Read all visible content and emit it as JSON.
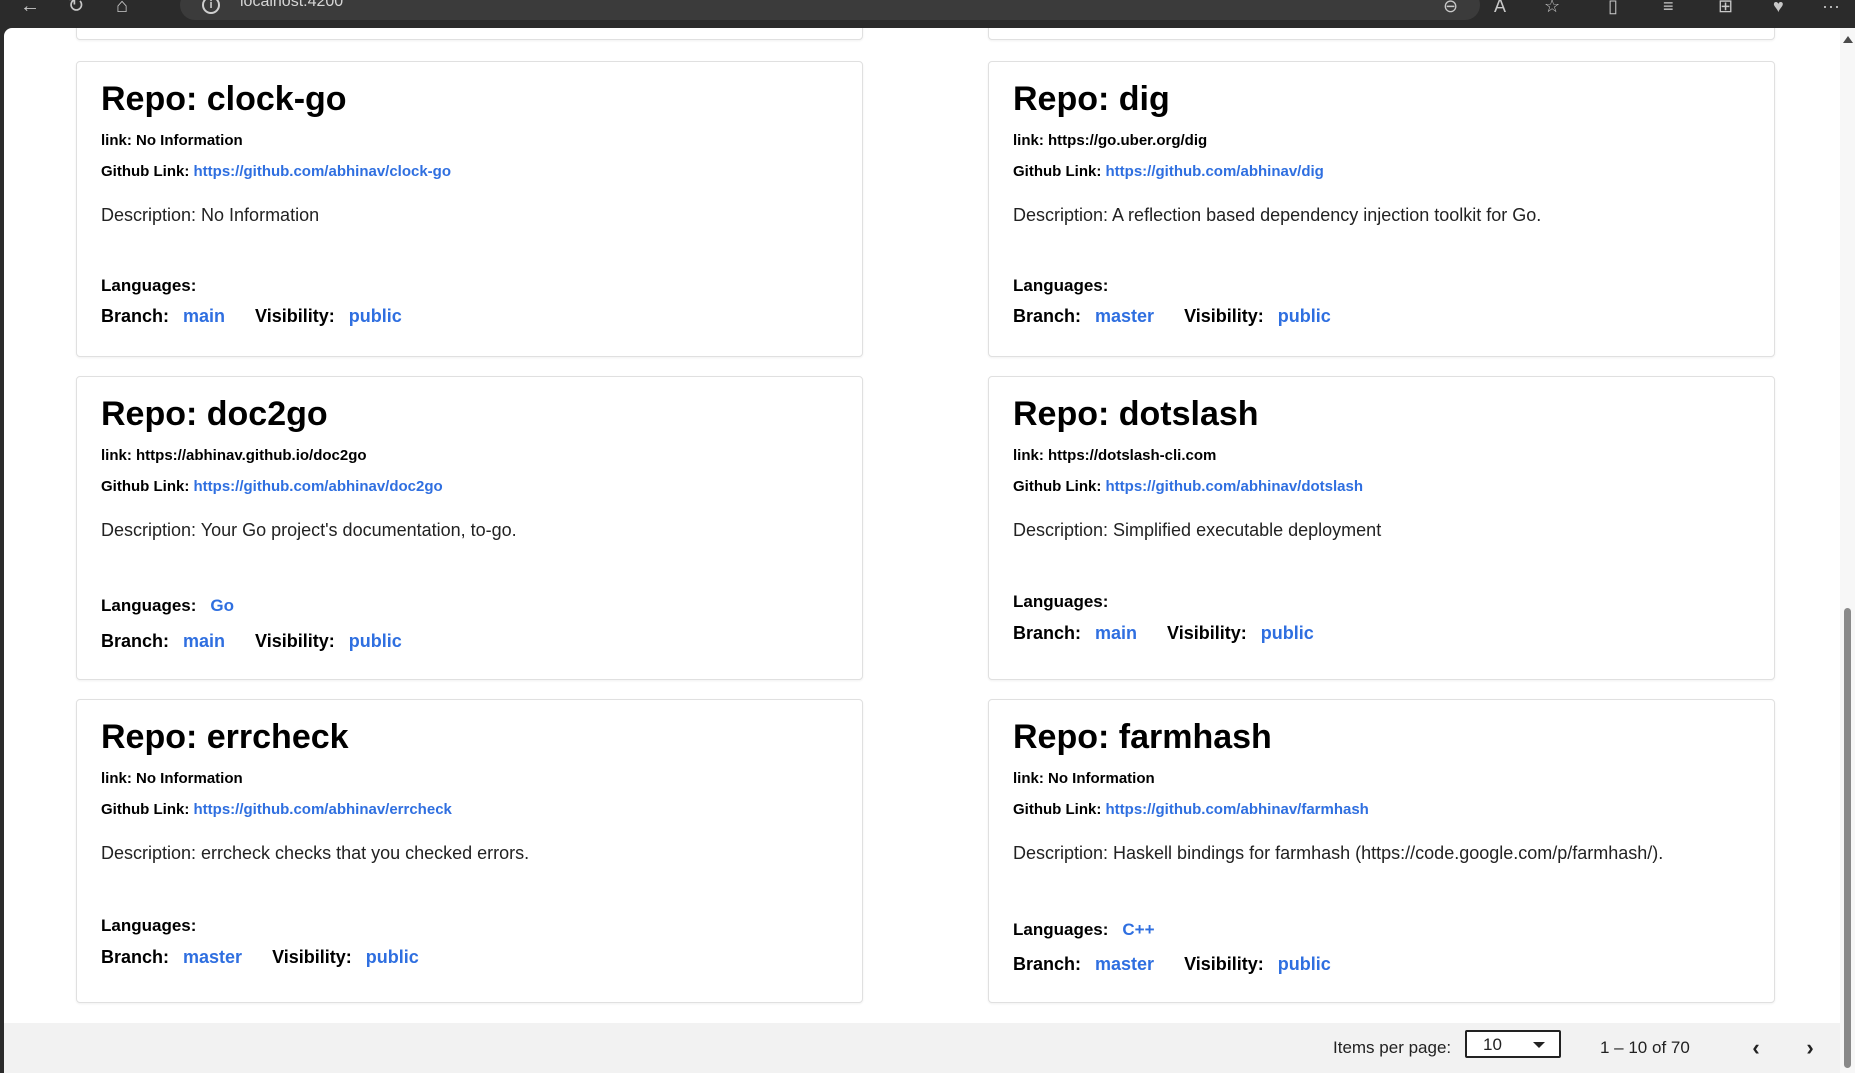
{
  "browser": {
    "url": "localhost:4200",
    "back_icon": "←",
    "refresh_icon": "↻",
    "home_icon": "⌂",
    "more_icon": "···"
  },
  "repos": [
    {
      "title": "Repo: clock-go",
      "link_label": "link:",
      "link_value": "No Information",
      "github_label": "Github Link:",
      "github_url": "https://github.com/abhinav/clock-go",
      "description": "Description: No Information",
      "languages_label": "Languages:",
      "languages_value": "",
      "branch_label": "Branch:",
      "branch_value": "main",
      "visibility_label": "Visibility:",
      "visibility_value": "public"
    },
    {
      "title": "Repo: dig",
      "link_label": "link:",
      "link_value": "https://go.uber.org/dig",
      "github_label": "Github Link:",
      "github_url": "https://github.com/abhinav/dig",
      "description": "Description: A reflection based dependency injection toolkit for Go.",
      "languages_label": "Languages:",
      "languages_value": "",
      "branch_label": "Branch:",
      "branch_value": "master",
      "visibility_label": "Visibility:",
      "visibility_value": "public"
    },
    {
      "title": "Repo: doc2go",
      "link_label": "link:",
      "link_value": "https://abhinav.github.io/doc2go",
      "github_label": "Github Link:",
      "github_url": "https://github.com/abhinav/doc2go",
      "description": "Description: Your Go project's documentation, to-go.",
      "languages_label": "Languages:",
      "languages_value": "Go",
      "branch_label": "Branch:",
      "branch_value": "main",
      "visibility_label": "Visibility:",
      "visibility_value": "public"
    },
    {
      "title": "Repo: dotslash",
      "link_label": "link:",
      "link_value": "https://dotslash-cli.com",
      "github_label": "Github Link:",
      "github_url": "https://github.com/abhinav/dotslash",
      "description": "Description: Simplified executable deployment",
      "languages_label": "Languages:",
      "languages_value": "",
      "branch_label": "Branch:",
      "branch_value": "main",
      "visibility_label": "Visibility:",
      "visibility_value": "public"
    },
    {
      "title": "Repo: errcheck",
      "link_label": "link:",
      "link_value": "No Information",
      "github_label": "Github Link:",
      "github_url": "https://github.com/abhinav/errcheck",
      "description": "Description: errcheck checks that you checked errors.",
      "languages_label": "Languages:",
      "languages_value": "",
      "branch_label": "Branch:",
      "branch_value": "master",
      "visibility_label": "Visibility:",
      "visibility_value": "public"
    },
    {
      "title": "Repo: farmhash",
      "link_label": "link:",
      "link_value": "No Information",
      "github_label": "Github Link:",
      "github_url": "https://github.com/abhinav/farmhash",
      "description": "Description: Haskell bindings for farmhash (https://code.google.com/p/farmhash/).",
      "languages_label": "Languages:",
      "languages_value": "C++",
      "branch_label": "Branch:",
      "branch_value": "master",
      "visibility_label": "Visibility:",
      "visibility_value": "public"
    }
  ],
  "paginator": {
    "items_per_page_label": "Items per page:",
    "items_per_page_value": "10",
    "range_label": "1 – 10 of 70",
    "prev_icon": "‹",
    "next_icon": "›"
  }
}
